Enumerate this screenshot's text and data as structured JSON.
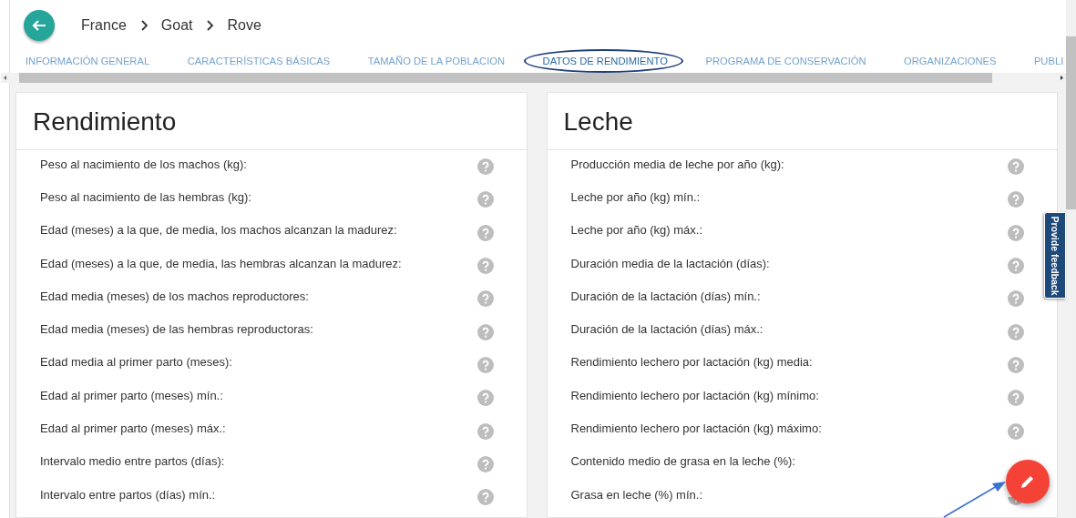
{
  "breadcrumb": [
    "France",
    "Goat",
    "Rove"
  ],
  "tabs": [
    {
      "label": "INFORMACIÓN GENERAL",
      "selected": false
    },
    {
      "label": "CARACTERÍSTICAS BÁSICAS",
      "selected": false
    },
    {
      "label": "TAMAÑO DE LA POBLACION",
      "selected": false
    },
    {
      "label": "DATOS DE RENDIMIENTO",
      "selected": true
    },
    {
      "label": "PROGRAMA DE CONSERVACIÓN",
      "selected": false
    },
    {
      "label": "ORGANIZACIONES",
      "selected": false
    },
    {
      "label": "PUBLI",
      "selected": false
    }
  ],
  "cards": [
    {
      "title": "Rendimiento",
      "rows": [
        "Peso al nacimiento de los machos (kg):",
        "Peso al nacimiento de las hembras (kg):",
        "Edad (meses) a la que, de media, los machos alcanzan la madurez:",
        "Edad (meses) a la que, de media, las hembras alcanzan la madurez:",
        "Edad media (meses) de los machos reproductores:",
        "Edad media (meses) de las hembras reproductoras:",
        "Edad media al primer parto (meses):",
        "Edad al primer parto (meses) mín.:",
        "Edad al primer parto (meses) máx.:",
        "Intervalo medio entre partos (días):",
        "Intervalo entre partos (días) mín.:"
      ]
    },
    {
      "title": "Leche",
      "rows": [
        "Producción media de leche por año (kg):",
        "Leche por año (kg) mín.:",
        "Leche por año (kg) máx.:",
        "Duración media de la lactación (días):",
        "Duración de la lactación (días) mín.:",
        "Duración de la lactación (días) máx.:",
        "Rendimiento lechero por lactación (kg) media:",
        "Rendimiento lechero por lactación (kg) mínimo:",
        "Rendimiento lechero por lactación (kg) máximo:",
        "Contenido medio de grasa en la leche (%):",
        "Grasa en leche (%) mín.:"
      ]
    }
  ],
  "feedback_tab": "Provide feedback"
}
